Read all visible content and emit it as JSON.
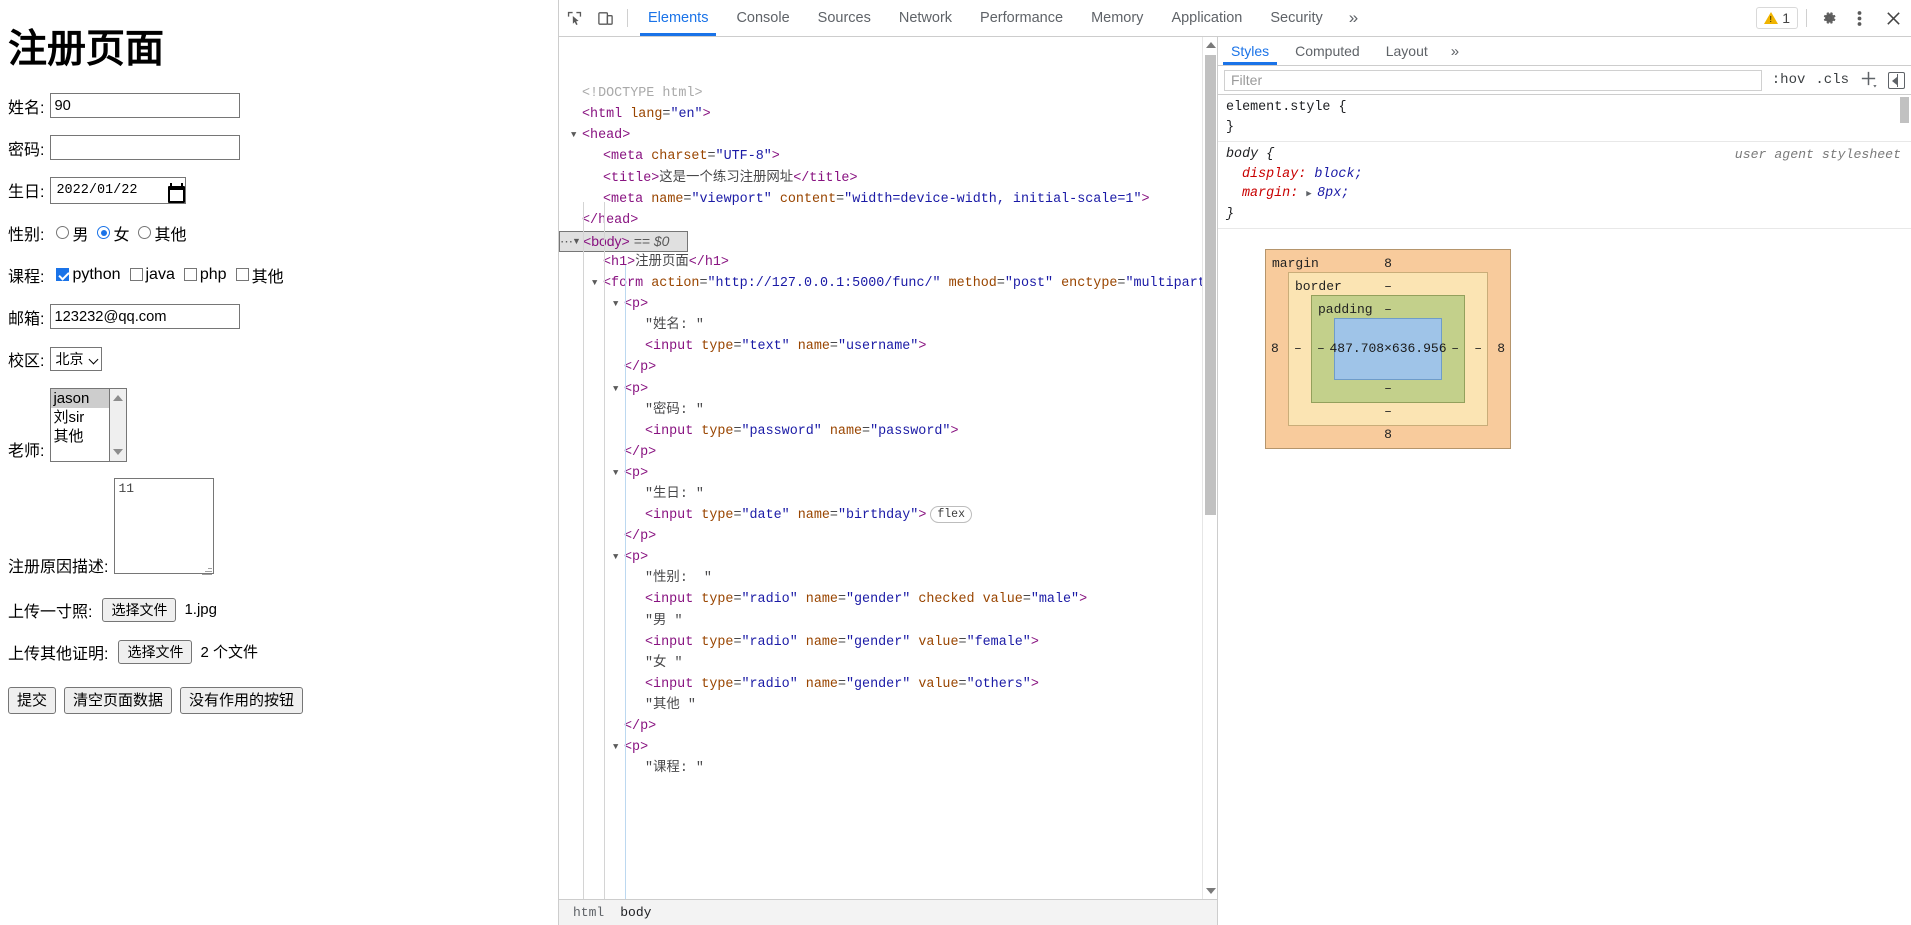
{
  "page": {
    "title": "注册页面",
    "fields": {
      "name_label": "姓名:",
      "name_value": "90",
      "password_label": "密码:",
      "password_value": "",
      "birthday_label": "生日:",
      "birthday_value": "2022/01/22",
      "gender_label": "性别:",
      "gender_options": [
        {
          "label": "男",
          "checked": false
        },
        {
          "label": "女",
          "checked": true
        },
        {
          "label": "其他",
          "checked": false
        }
      ],
      "course_label": "课程:",
      "course_options": [
        {
          "label": "python",
          "checked": true
        },
        {
          "label": "java",
          "checked": false
        },
        {
          "label": "php",
          "checked": false
        },
        {
          "label": "其他",
          "checked": false
        }
      ],
      "email_label": "邮箱:",
      "email_value": "123232@qq.com",
      "campus_label": "校区:",
      "campus_value": "北京",
      "teacher_label": "老师:",
      "teacher_options": [
        "jason",
        "刘sir",
        "其他"
      ],
      "teacher_selected": "jason",
      "reason_label": "注册原因描述:",
      "reason_value": "11",
      "photo_label": "上传一寸照:",
      "photo_button": "选择文件",
      "photo_filename": "1.jpg",
      "other_label": "上传其他证明:",
      "other_button": "选择文件",
      "other_filename": "2 个文件"
    },
    "buttons": {
      "submit": "提交",
      "clear": "清空页面数据",
      "useless": "没有作用的按钮"
    }
  },
  "devtools": {
    "tabs": [
      {
        "label": "Elements",
        "active": true
      },
      {
        "label": "Console",
        "active": false
      },
      {
        "label": "Sources",
        "active": false
      },
      {
        "label": "Network",
        "active": false
      },
      {
        "label": "Performance",
        "active": false
      },
      {
        "label": "Memory",
        "active": false
      },
      {
        "label": "Application",
        "active": false
      },
      {
        "label": "Security",
        "active": false
      }
    ],
    "overflow_tabs": "»",
    "warning_count": "1",
    "dom_lines": [
      {
        "indent": 0,
        "twisty": "none",
        "parts": [
          {
            "c": "doctype",
            "t": "<!DOCTYPE html>"
          }
        ]
      },
      {
        "indent": 0,
        "twisty": "none",
        "parts": [
          {
            "c": "punc",
            "t": "<"
          },
          {
            "c": "tag",
            "t": "html"
          },
          {
            "c": "txt",
            "t": " "
          },
          {
            "c": "attr",
            "t": "lang"
          },
          {
            "c": "txt",
            "t": "="
          },
          {
            "c": "val",
            "t": "\"en\""
          },
          {
            "c": "punc",
            "t": ">"
          }
        ]
      },
      {
        "indent": 0,
        "twisty": "open",
        "parts": [
          {
            "c": "punc",
            "t": "<"
          },
          {
            "c": "tag",
            "t": "head"
          },
          {
            "c": "punc",
            "t": ">"
          }
        ]
      },
      {
        "indent": 1,
        "twisty": "none",
        "parts": [
          {
            "c": "punc",
            "t": "<"
          },
          {
            "c": "tag",
            "t": "meta"
          },
          {
            "c": "txt",
            "t": " "
          },
          {
            "c": "attr",
            "t": "charset"
          },
          {
            "c": "txt",
            "t": "="
          },
          {
            "c": "val",
            "t": "\"UTF-8\""
          },
          {
            "c": "punc",
            "t": ">"
          }
        ]
      },
      {
        "indent": 1,
        "twisty": "none",
        "parts": [
          {
            "c": "punc",
            "t": "<"
          },
          {
            "c": "tag",
            "t": "title"
          },
          {
            "c": "punc",
            "t": ">"
          },
          {
            "c": "txt",
            "t": "这是一个练习注册网址"
          },
          {
            "c": "punc",
            "t": "</"
          },
          {
            "c": "tag",
            "t": "title"
          },
          {
            "c": "punc",
            "t": ">"
          }
        ]
      },
      {
        "indent": 1,
        "twisty": "none",
        "parts": [
          {
            "c": "punc",
            "t": "<"
          },
          {
            "c": "tag",
            "t": "meta"
          },
          {
            "c": "txt",
            "t": " "
          },
          {
            "c": "attr",
            "t": "name"
          },
          {
            "c": "txt",
            "t": "="
          },
          {
            "c": "val",
            "t": "\"viewport\""
          },
          {
            "c": "txt",
            "t": " "
          },
          {
            "c": "attr",
            "t": "content"
          },
          {
            "c": "txt",
            "t": "="
          },
          {
            "c": "val",
            "t": "\"width=device-width, initial-scale=1\""
          },
          {
            "c": "punc",
            "t": ">"
          }
        ]
      },
      {
        "indent": 0,
        "twisty": "none",
        "parts": [
          {
            "c": "punc",
            "t": "</"
          },
          {
            "c": "tag",
            "t": "head"
          },
          {
            "c": "punc",
            "t": ">"
          }
        ]
      },
      {
        "indent": 0,
        "twisty": "open",
        "selected": true,
        "dots": true,
        "parts": [
          {
            "c": "punc",
            "t": "<"
          },
          {
            "c": "tag",
            "t": "body"
          },
          {
            "c": "punc",
            "t": ">"
          },
          {
            "c": "eqd",
            "t": " == $0"
          }
        ]
      },
      {
        "indent": 1,
        "twisty": "none",
        "parts": [
          {
            "c": "punc",
            "t": "<"
          },
          {
            "c": "tag",
            "t": "h1"
          },
          {
            "c": "punc",
            "t": ">"
          },
          {
            "c": "txt",
            "t": "注册页面"
          },
          {
            "c": "punc",
            "t": "</"
          },
          {
            "c": "tag",
            "t": "h1"
          },
          {
            "c": "punc",
            "t": ">"
          }
        ]
      },
      {
        "indent": 1,
        "twisty": "open",
        "wrap": true,
        "parts": [
          {
            "c": "punc",
            "t": "<"
          },
          {
            "c": "tag",
            "t": "form"
          },
          {
            "c": "txt",
            "t": " "
          },
          {
            "c": "attr",
            "t": "action"
          },
          {
            "c": "txt",
            "t": "="
          },
          {
            "c": "val",
            "t": "\"http://127.0.0.1:5000/func/\""
          },
          {
            "c": "txt",
            "t": " "
          },
          {
            "c": "attr",
            "t": "method"
          },
          {
            "c": "txt",
            "t": "="
          },
          {
            "c": "val",
            "t": "\"post\""
          },
          {
            "c": "txt",
            "t": " "
          },
          {
            "c": "attr",
            "t": "enctype"
          },
          {
            "c": "txt",
            "t": "="
          },
          {
            "c": "val",
            "t": "\"multipart/form-data\""
          },
          {
            "c": "punc",
            "t": ">"
          }
        ]
      },
      {
        "indent": 2,
        "twisty": "open",
        "parts": [
          {
            "c": "punc",
            "t": "<"
          },
          {
            "c": "tag",
            "t": "p"
          },
          {
            "c": "punc",
            "t": ">"
          }
        ]
      },
      {
        "indent": 3,
        "twisty": "none",
        "parts": [
          {
            "c": "txt",
            "t": "\"姓名: \""
          }
        ]
      },
      {
        "indent": 3,
        "twisty": "none",
        "parts": [
          {
            "c": "punc",
            "t": "<"
          },
          {
            "c": "tag",
            "t": "input"
          },
          {
            "c": "txt",
            "t": " "
          },
          {
            "c": "attr",
            "t": "type"
          },
          {
            "c": "txt",
            "t": "="
          },
          {
            "c": "val",
            "t": "\"text\""
          },
          {
            "c": "txt",
            "t": " "
          },
          {
            "c": "attr",
            "t": "name"
          },
          {
            "c": "txt",
            "t": "="
          },
          {
            "c": "val",
            "t": "\"username\""
          },
          {
            "c": "punc",
            "t": ">"
          }
        ]
      },
      {
        "indent": 2,
        "twisty": "none",
        "parts": [
          {
            "c": "punc",
            "t": "</"
          },
          {
            "c": "tag",
            "t": "p"
          },
          {
            "c": "punc",
            "t": ">"
          }
        ]
      },
      {
        "indent": 2,
        "twisty": "open",
        "parts": [
          {
            "c": "punc",
            "t": "<"
          },
          {
            "c": "tag",
            "t": "p"
          },
          {
            "c": "punc",
            "t": ">"
          }
        ]
      },
      {
        "indent": 3,
        "twisty": "none",
        "parts": [
          {
            "c": "txt",
            "t": "\"密码: \""
          }
        ]
      },
      {
        "indent": 3,
        "twisty": "none",
        "parts": [
          {
            "c": "punc",
            "t": "<"
          },
          {
            "c": "tag",
            "t": "input"
          },
          {
            "c": "txt",
            "t": " "
          },
          {
            "c": "attr",
            "t": "type"
          },
          {
            "c": "txt",
            "t": "="
          },
          {
            "c": "val",
            "t": "\"password\""
          },
          {
            "c": "txt",
            "t": " "
          },
          {
            "c": "attr",
            "t": "name"
          },
          {
            "c": "txt",
            "t": "="
          },
          {
            "c": "val",
            "t": "\"password\""
          },
          {
            "c": "punc",
            "t": ">"
          }
        ]
      },
      {
        "indent": 2,
        "twisty": "none",
        "parts": [
          {
            "c": "punc",
            "t": "</"
          },
          {
            "c": "tag",
            "t": "p"
          },
          {
            "c": "punc",
            "t": ">"
          }
        ]
      },
      {
        "indent": 2,
        "twisty": "open",
        "parts": [
          {
            "c": "punc",
            "t": "<"
          },
          {
            "c": "tag",
            "t": "p"
          },
          {
            "c": "punc",
            "t": ">"
          }
        ]
      },
      {
        "indent": 3,
        "twisty": "none",
        "parts": [
          {
            "c": "txt",
            "t": "\"生日: \""
          }
        ]
      },
      {
        "indent": 3,
        "twisty": "none",
        "badge": "flex",
        "parts": [
          {
            "c": "punc",
            "t": "<"
          },
          {
            "c": "tag",
            "t": "input"
          },
          {
            "c": "txt",
            "t": " "
          },
          {
            "c": "attr",
            "t": "type"
          },
          {
            "c": "txt",
            "t": "="
          },
          {
            "c": "val",
            "t": "\"date\""
          },
          {
            "c": "txt",
            "t": " "
          },
          {
            "c": "attr",
            "t": "name"
          },
          {
            "c": "txt",
            "t": "="
          },
          {
            "c": "val",
            "t": "\"birthday\""
          },
          {
            "c": "punc",
            "t": ">"
          }
        ]
      },
      {
        "indent": 2,
        "twisty": "none",
        "parts": [
          {
            "c": "punc",
            "t": "</"
          },
          {
            "c": "tag",
            "t": "p"
          },
          {
            "c": "punc",
            "t": ">"
          }
        ]
      },
      {
        "indent": 2,
        "twisty": "open",
        "parts": [
          {
            "c": "punc",
            "t": "<"
          },
          {
            "c": "tag",
            "t": "p"
          },
          {
            "c": "punc",
            "t": ">"
          }
        ]
      },
      {
        "indent": 3,
        "twisty": "none",
        "parts": [
          {
            "c": "txt",
            "t": "\"性别:  \""
          }
        ]
      },
      {
        "indent": 3,
        "twisty": "none",
        "parts": [
          {
            "c": "punc",
            "t": "<"
          },
          {
            "c": "tag",
            "t": "input"
          },
          {
            "c": "txt",
            "t": " "
          },
          {
            "c": "attr",
            "t": "type"
          },
          {
            "c": "txt",
            "t": "="
          },
          {
            "c": "val",
            "t": "\"radio\""
          },
          {
            "c": "txt",
            "t": " "
          },
          {
            "c": "attr",
            "t": "name"
          },
          {
            "c": "txt",
            "t": "="
          },
          {
            "c": "val",
            "t": "\"gender\""
          },
          {
            "c": "txt",
            "t": " "
          },
          {
            "c": "attr",
            "t": "checked"
          },
          {
            "c": "txt",
            "t": " "
          },
          {
            "c": "attr",
            "t": "value"
          },
          {
            "c": "txt",
            "t": "="
          },
          {
            "c": "val",
            "t": "\"male\""
          },
          {
            "c": "punc",
            "t": ">"
          }
        ]
      },
      {
        "indent": 3,
        "twisty": "none",
        "parts": [
          {
            "c": "txt",
            "t": "\"男 \""
          }
        ]
      },
      {
        "indent": 3,
        "twisty": "none",
        "parts": [
          {
            "c": "punc",
            "t": "<"
          },
          {
            "c": "tag",
            "t": "input"
          },
          {
            "c": "txt",
            "t": " "
          },
          {
            "c": "attr",
            "t": "type"
          },
          {
            "c": "txt",
            "t": "="
          },
          {
            "c": "val",
            "t": "\"radio\""
          },
          {
            "c": "txt",
            "t": " "
          },
          {
            "c": "attr",
            "t": "name"
          },
          {
            "c": "txt",
            "t": "="
          },
          {
            "c": "val",
            "t": "\"gender\""
          },
          {
            "c": "txt",
            "t": " "
          },
          {
            "c": "attr",
            "t": "value"
          },
          {
            "c": "txt",
            "t": "="
          },
          {
            "c": "val",
            "t": "\"female\""
          },
          {
            "c": "punc",
            "t": ">"
          }
        ]
      },
      {
        "indent": 3,
        "twisty": "none",
        "parts": [
          {
            "c": "txt",
            "t": "\"女 \""
          }
        ]
      },
      {
        "indent": 3,
        "twisty": "none",
        "parts": [
          {
            "c": "punc",
            "t": "<"
          },
          {
            "c": "tag",
            "t": "input"
          },
          {
            "c": "txt",
            "t": " "
          },
          {
            "c": "attr",
            "t": "type"
          },
          {
            "c": "txt",
            "t": "="
          },
          {
            "c": "val",
            "t": "\"radio\""
          },
          {
            "c": "txt",
            "t": " "
          },
          {
            "c": "attr",
            "t": "name"
          },
          {
            "c": "txt",
            "t": "="
          },
          {
            "c": "val",
            "t": "\"gender\""
          },
          {
            "c": "txt",
            "t": " "
          },
          {
            "c": "attr",
            "t": "value"
          },
          {
            "c": "txt",
            "t": "="
          },
          {
            "c": "val",
            "t": "\"others\""
          },
          {
            "c": "punc",
            "t": ">"
          }
        ]
      },
      {
        "indent": 3,
        "twisty": "none",
        "parts": [
          {
            "c": "txt",
            "t": "\"其他 \""
          }
        ]
      },
      {
        "indent": 2,
        "twisty": "none",
        "parts": [
          {
            "c": "punc",
            "t": "</"
          },
          {
            "c": "tag",
            "t": "p"
          },
          {
            "c": "punc",
            "t": ">"
          }
        ]
      },
      {
        "indent": 2,
        "twisty": "open",
        "parts": [
          {
            "c": "punc",
            "t": "<"
          },
          {
            "c": "tag",
            "t": "p"
          },
          {
            "c": "punc",
            "t": ">"
          }
        ]
      },
      {
        "indent": 3,
        "twisty": "none",
        "parts": [
          {
            "c": "txt",
            "t": "\"课程: \""
          }
        ]
      }
    ],
    "breadcrumb": [
      "html",
      "body"
    ],
    "styles": {
      "tabs": [
        {
          "label": "Styles",
          "active": true
        },
        {
          "label": "Computed",
          "active": false
        },
        {
          "label": "Layout",
          "active": false
        }
      ],
      "overflow": "»",
      "filter_placeholder": "Filter",
      "hov": ":hov",
      "cls": ".cls",
      "rules": [
        {
          "selector": "element.style {",
          "origin": "",
          "props": [],
          "close": "}"
        },
        {
          "selector": "body {",
          "origin": "user agent stylesheet",
          "italic": true,
          "props": [
            {
              "name": "display",
              "value": "block",
              "arrow": false
            },
            {
              "name": "margin",
              "value": "8px",
              "arrow": true
            }
          ],
          "close": "}"
        }
      ]
    },
    "box_model": {
      "margin_label": "margin",
      "margin_top": "8",
      "margin_right": "8",
      "margin_bottom": "8",
      "margin_left": "8",
      "border_label": "border",
      "border_top": "–",
      "border_right": "–",
      "border_bottom": "–",
      "border_left": "–",
      "padding_label": "padding",
      "padding_top": "–",
      "padding_right": "–",
      "padding_bottom": "–",
      "padding_left": "–",
      "content_size": "487.708×636.956"
    }
  }
}
